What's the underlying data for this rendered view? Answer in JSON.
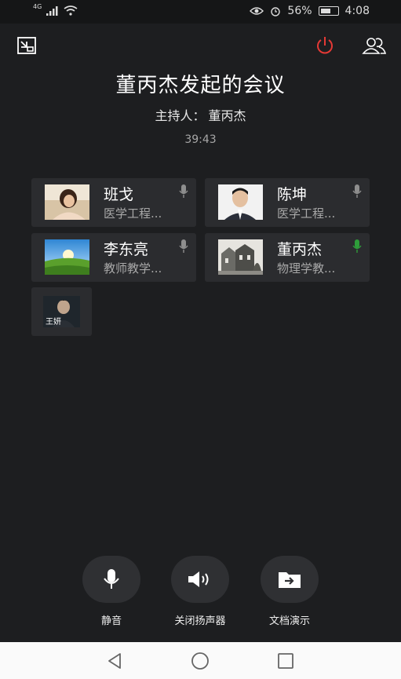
{
  "status_bar": {
    "network": "4G",
    "battery": "56%",
    "time": "4:08"
  },
  "meeting": {
    "title": "董丙杰发起的会议",
    "host_label": "主持人：",
    "host_name": "董丙杰",
    "timer": "39:43"
  },
  "participants": [
    {
      "name": "班戈",
      "dept": "医学工程...",
      "mic_active": false
    },
    {
      "name": "陈坤",
      "dept": "医学工程...",
      "mic_active": false
    },
    {
      "name": "李东亮",
      "dept": "教师教学...",
      "mic_active": false
    },
    {
      "name": "董丙杰",
      "dept": "物理学教...",
      "mic_active": true
    }
  ],
  "extra_participant": {
    "name": "王妍"
  },
  "controls": {
    "mute_label": "静音",
    "speaker_label": "关闭扬声器",
    "share_label": "文档演示"
  },
  "colors": {
    "end_call": "#e53935",
    "mic_active": "#2e9d3a",
    "background": "#1d1e20",
    "card": "#2b2c2f"
  }
}
